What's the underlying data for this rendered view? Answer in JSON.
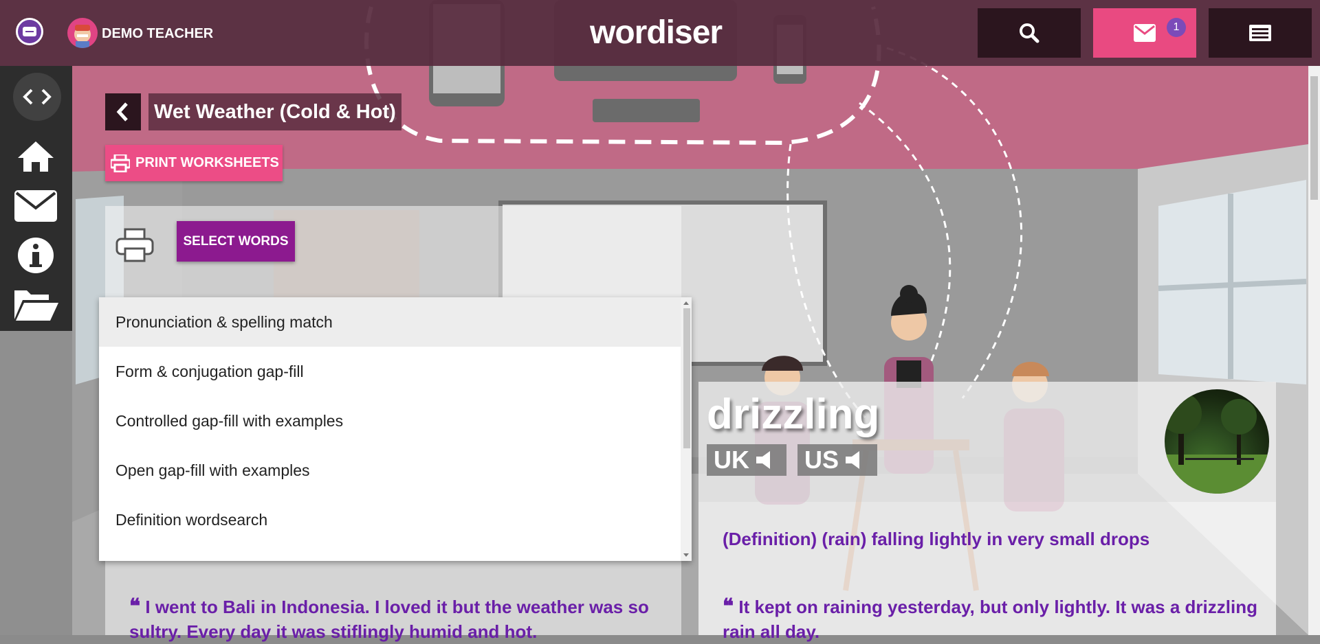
{
  "header": {
    "user_name": "DEMO TEACHER",
    "logo_text": "wordiser",
    "message_count": "1"
  },
  "icons": {
    "menu": "menu-icon",
    "avatar": "teacher-avatar",
    "search": "search-icon",
    "messages": "envelope-icon",
    "board": "list-board-icon",
    "code": "code-brackets-icon",
    "home": "home-icon",
    "mail": "mail-icon",
    "info": "info-icon",
    "folder": "folder-open-icon",
    "back": "chevron-left-icon",
    "printer": "printer-icon",
    "speaker": "speaker-icon",
    "quote": "quote-icon"
  },
  "page": {
    "title": "Wet Weather (Cold & Hot)",
    "print_button": "PRINT WORKSHEETS",
    "select_words_button": "SELECT WORDS"
  },
  "dropdown": {
    "items": [
      "Pronunciation & spelling match",
      "Form & conjugation gap-fill",
      "Controlled gap-fill with examples",
      "Open gap-fill with examples",
      "Definition wordsearch"
    ],
    "highlighted_index": 0
  },
  "left_card": {
    "example": "I went to Bali in Indonesia. I loved it but the weather was so sultry. Every day it was stiflingly humid and hot."
  },
  "word_card": {
    "word": "drizzling",
    "uk_label": "UK",
    "us_label": "US",
    "definition": "(Definition) (rain) falling lightly in very small drops",
    "example": "It kept on raining yesterday, but only lightly. It was a drizzling rain all day."
  },
  "colors": {
    "header_bg": "#582a3e",
    "accent_pink": "#ec4d86",
    "select_purple": "#8c1a8f",
    "text_purple": "#6a1fa8",
    "dark_button": "#2b151e",
    "badge": "#7b4bb9"
  }
}
